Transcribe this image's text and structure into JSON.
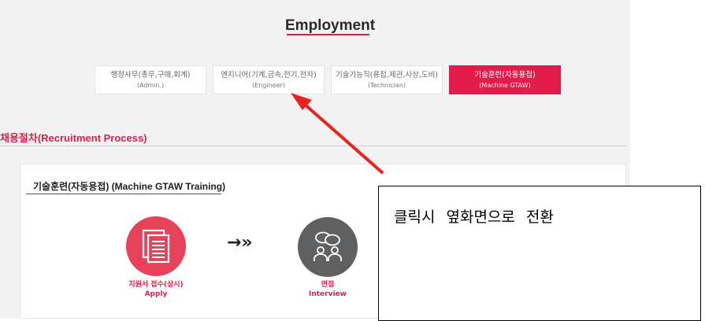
{
  "page_title": "Employment",
  "tabs": [
    {
      "label": "행정사무(총무,구매,회계)",
      "sub": "(Admin.)",
      "active": false
    },
    {
      "label": "엔지니어(기계,금속,전기,전자)",
      "sub": "(Engineer)",
      "active": false
    },
    {
      "label": "기술기능직(용접,제관,사상,도비)",
      "sub": "(Technician)",
      "active": false
    },
    {
      "label": "기술훈련(자동용접)",
      "sub": "(Machine GTAW)",
      "active": true
    }
  ],
  "section": {
    "heading": "채용절차(Recruitment Process)"
  },
  "training": {
    "title": "기술훈련(자동용접) (Machine GTAW Training)",
    "steps": [
      {
        "label_ko": "지원서 접수(상시)",
        "label_en": "Apply",
        "icon": "application-document-icon"
      },
      {
        "label_ko": "면접",
        "label_en": "Interview",
        "icon": "interview-people-icon"
      }
    ],
    "flow_arrow": "→»"
  },
  "annotation": {
    "callout_text": "클릭시 옆화면으로 전환"
  },
  "colors": {
    "accent": "#e31d4b",
    "step_red": "#e8415a",
    "step_gray": "#5f6061",
    "page_bg": "#f3f3f3",
    "annotation_arrow": "#e8231f"
  }
}
